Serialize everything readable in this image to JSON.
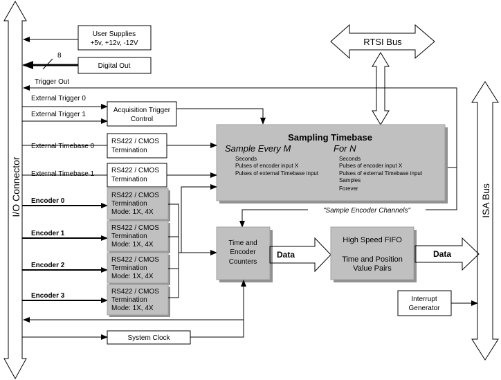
{
  "buses": {
    "io": "I/O Connector",
    "isa": "ISA Bus",
    "rtsi": "RTSI Bus"
  },
  "signals": {
    "trigger_out": "Trigger Out",
    "ext_trigger_0": "External Trigger 0",
    "ext_trigger_1": "External Trigger 1",
    "ext_timebase_0": "External Timebase 0",
    "ext_timebase_1": "External Timebase 1",
    "encoders": [
      "Encoder 0",
      "Encoder 1",
      "Encoder 2",
      "Encoder 3"
    ],
    "digital_width": "8",
    "sample_encoder": "\"Sample Encoder Channels\"",
    "data1": "Data",
    "data2": "Data"
  },
  "boxes": {
    "user_supplies": [
      "User Supplies",
      "+5v, +12v, -12V"
    ],
    "digital_out": "Digital Out",
    "acq_trigger": [
      "Acquisition Trigger",
      "Control"
    ],
    "rs422": [
      "RS422 / CMOS",
      "Termination"
    ],
    "rs422_enc": [
      "RS422 / CMOS",
      "Termination",
      "Mode: 1X, 4X"
    ],
    "counters": [
      "Time and",
      "Encoder",
      "Counters"
    ],
    "fifo": [
      "High Speed FIFO",
      "Time and Position",
      "Value Pairs"
    ],
    "interrupt": [
      "Interrupt",
      "Generator"
    ],
    "system_clock": "System Clock"
  },
  "timebase": {
    "title": "Sampling Timebase",
    "every": "Sample Every M",
    "every_items": [
      "Seconds",
      "Pulses of encoder input X",
      "Pulses of external Timebase input"
    ],
    "for": "For N",
    "for_items": [
      "Seconds",
      "Pulses of encoder input X",
      "Pulses of external Timebase input",
      "Samples",
      "Forever"
    ]
  }
}
